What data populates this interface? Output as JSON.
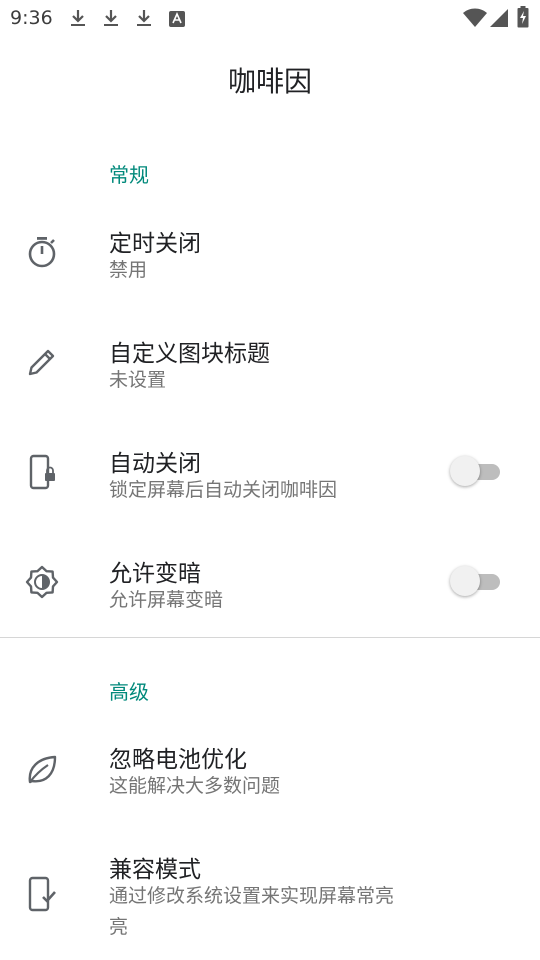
{
  "status_bar": {
    "time": "9:36",
    "notification_icons": [
      "download-icon",
      "download-icon",
      "download-icon",
      "font-app-icon"
    ],
    "system_icons": [
      "wifi-icon",
      "cell-signal-icon",
      "battery-charging-icon"
    ]
  },
  "app_bar": {
    "title": "咖啡因"
  },
  "sections": {
    "general": {
      "header": "常规"
    },
    "advanced": {
      "header": "高级"
    }
  },
  "items": {
    "timer": {
      "title": "定时关闭",
      "summary": "禁用",
      "icon": "timer-icon"
    },
    "tile_title": {
      "title": "自定义图块标题",
      "summary": "未设置",
      "icon": "pencil-icon"
    },
    "auto_off": {
      "title": "自动关闭",
      "summary": "锁定屏幕后自动关闭咖啡因",
      "icon": "phone-lock-icon",
      "toggle_on": false
    },
    "allow_dim": {
      "title": "允许变暗",
      "summary": "允许屏幕变暗",
      "icon": "brightness-icon",
      "toggle_on": false
    },
    "battery_opt": {
      "title": "忽略电池优化",
      "summary": "这能解决大多数问题",
      "icon": "leaf-icon"
    },
    "compat_mode": {
      "title": "兼容模式",
      "summary_line1": "通过修改系统设置来实现屏幕常亮",
      "summary_line2": "亮",
      "icon": "phone-check-icon"
    }
  },
  "colors": {
    "accent": "#00897b",
    "text_primary": "#202124",
    "text_secondary": "#757575",
    "icon": "#5f6368"
  }
}
